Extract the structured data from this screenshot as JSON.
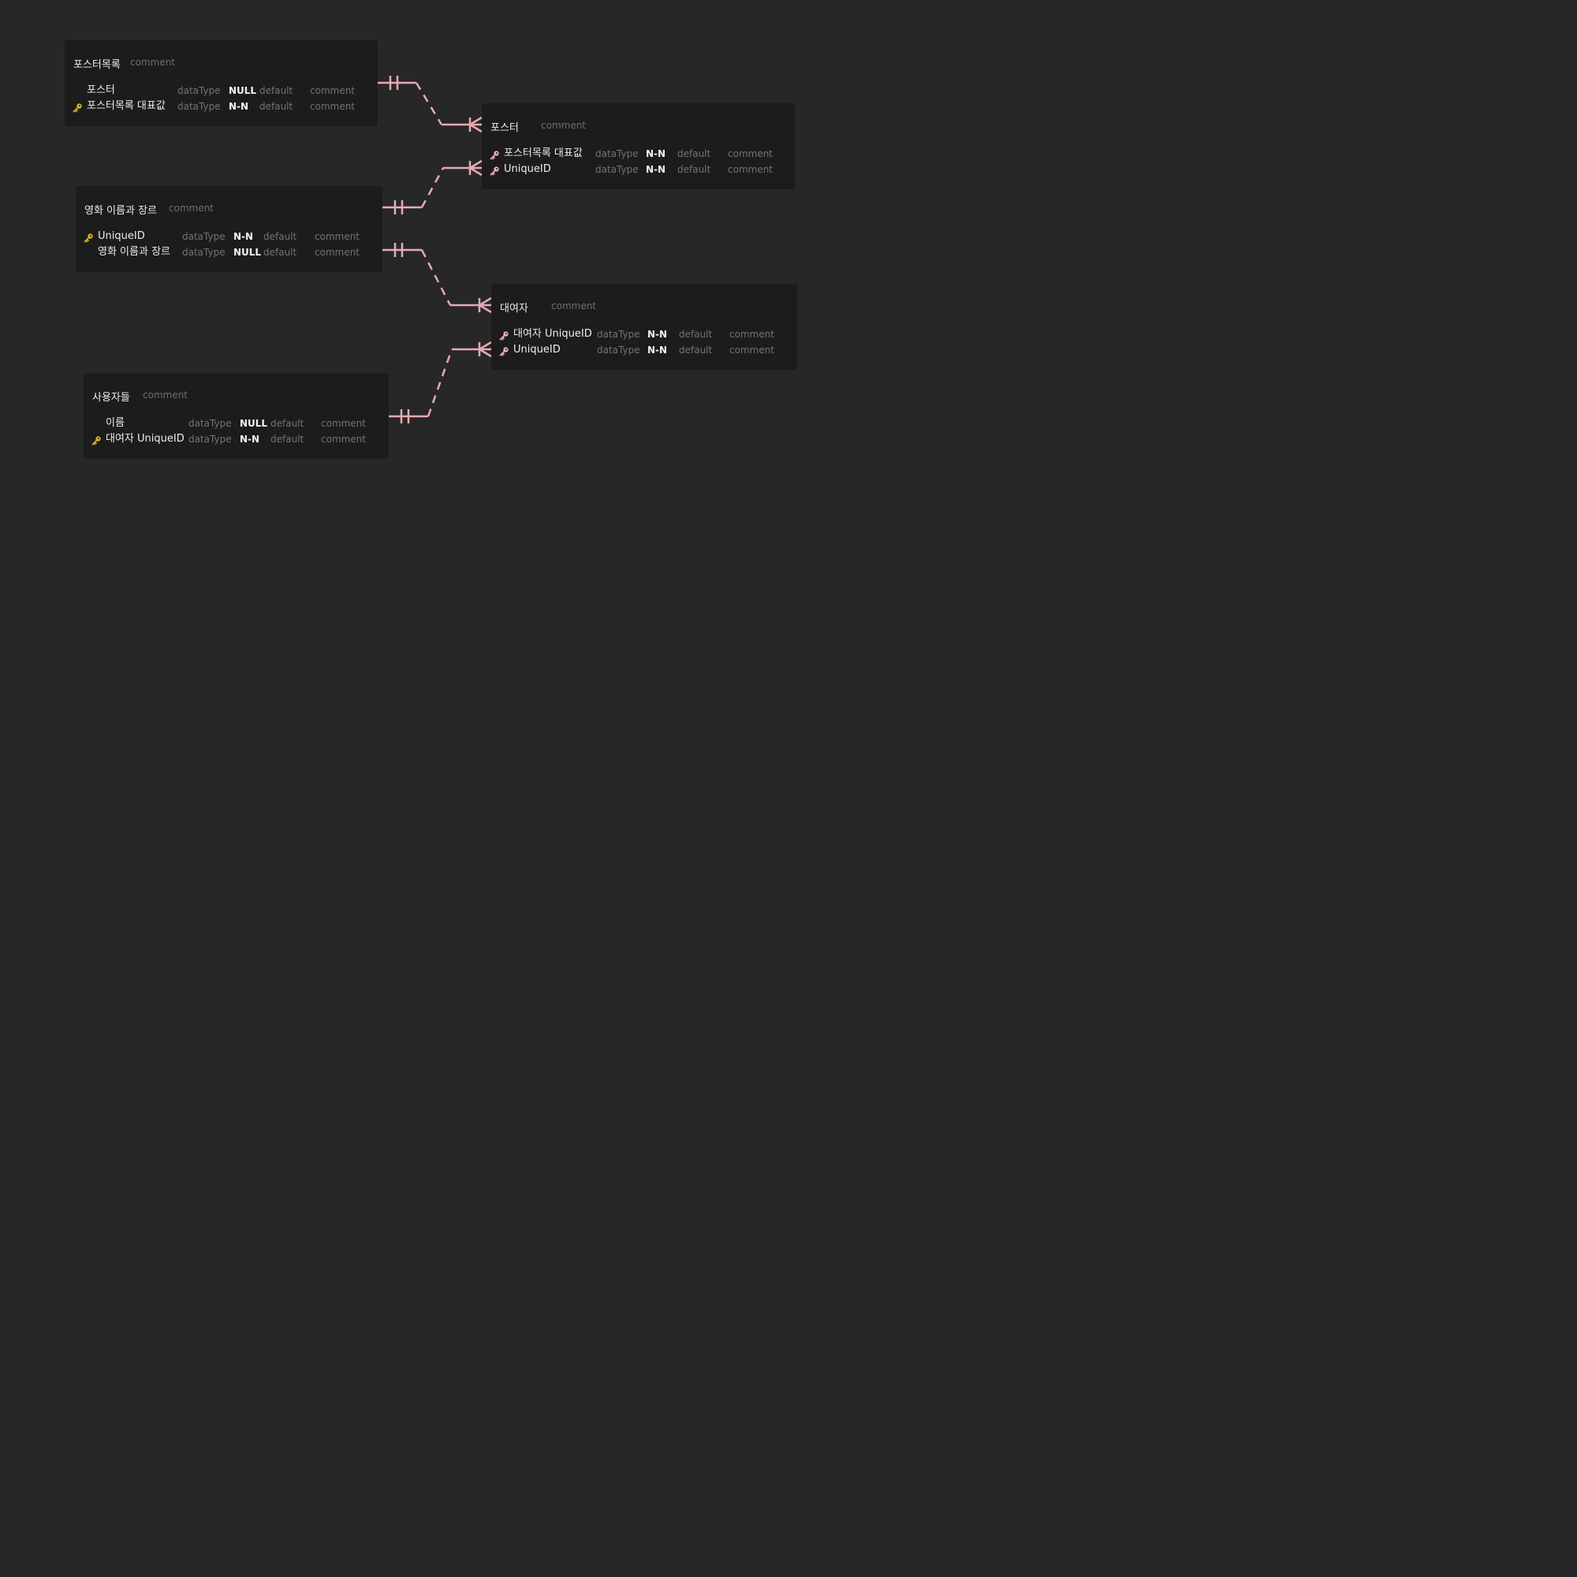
{
  "diagram": {
    "relation_color": "#e8aab3",
    "pk_key_color": "#d4b21f",
    "fk_key_color": "#e8aab3",
    "tables": [
      {
        "id": "poster-list",
        "name": "포스터목록",
        "comment": "comment",
        "columns": [
          {
            "key": "none",
            "name": "포스터",
            "dataType": "dataType",
            "nullable": "NULL",
            "default": "default",
            "comment": "comment"
          },
          {
            "key": "pk",
            "name": "포스터목록 대표값",
            "dataType": "dataType",
            "nullable": "N-N",
            "default": "default",
            "comment": "comment"
          }
        ]
      },
      {
        "id": "poster",
        "name": "포스터",
        "comment": "comment",
        "columns": [
          {
            "key": "fk",
            "name": "포스터목록 대표값",
            "dataType": "dataType",
            "nullable": "N-N",
            "default": "default",
            "comment": "comment"
          },
          {
            "key": "fk",
            "name": "UniqueID",
            "dataType": "dataType",
            "nullable": "N-N",
            "default": "default",
            "comment": "comment"
          }
        ]
      },
      {
        "id": "movie",
        "name": "영화 이름과 장르",
        "comment": "comment",
        "columns": [
          {
            "key": "pk",
            "name": "UniqueID",
            "dataType": "dataType",
            "nullable": "N-N",
            "default": "default",
            "comment": "comment"
          },
          {
            "key": "none",
            "name": "영화 이름과 장르",
            "dataType": "dataType",
            "nullable": "NULL",
            "default": "default",
            "comment": "comment"
          }
        ]
      },
      {
        "id": "renter",
        "name": "대여자",
        "comment": "comment",
        "columns": [
          {
            "key": "fk",
            "name": "대여자 UniqueID",
            "dataType": "dataType",
            "nullable": "N-N",
            "default": "default",
            "comment": "comment"
          },
          {
            "key": "fk",
            "name": "UniqueID",
            "dataType": "dataType",
            "nullable": "N-N",
            "default": "default",
            "comment": "comment"
          }
        ]
      },
      {
        "id": "users",
        "name": "사용자들",
        "comment": "comment",
        "columns": [
          {
            "key": "none",
            "name": "이름",
            "dataType": "dataType",
            "nullable": "NULL",
            "default": "default",
            "comment": "comment"
          },
          {
            "key": "pk",
            "name": "대여자 UniqueID",
            "dataType": "dataType",
            "nullable": "N-N",
            "default": "default",
            "comment": "comment"
          }
        ]
      }
    ],
    "relations": [
      {
        "from": "poster-list",
        "from_column": "포스터목록 대표값",
        "to": "poster",
        "to_column": "포스터목록 대표값",
        "from_cardinality": "one-and-only-one",
        "to_cardinality": "one-or-many",
        "line": "dashed"
      },
      {
        "from": "movie",
        "from_column": "UniqueID",
        "to": "poster",
        "to_column": "UniqueID",
        "from_cardinality": "one-and-only-one",
        "to_cardinality": "one-or-many",
        "line": "dashed"
      },
      {
        "from": "movie",
        "from_column": "UniqueID",
        "to": "renter",
        "to_column": "UniqueID",
        "from_cardinality": "one-and-only-one",
        "to_cardinality": "one-or-many",
        "line": "dashed"
      },
      {
        "from": "users",
        "from_column": "대여자 UniqueID",
        "to": "renter",
        "to_column": "대여자 UniqueID",
        "from_cardinality": "one-and-only-one",
        "to_cardinality": "one-or-many",
        "line": "dashed"
      }
    ]
  }
}
